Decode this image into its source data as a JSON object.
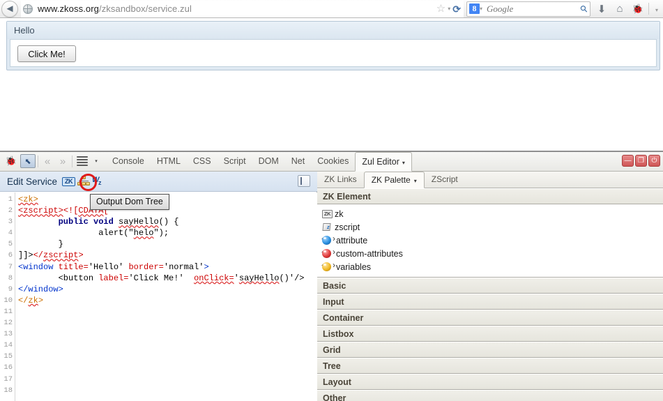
{
  "browser": {
    "back_label": "◄",
    "url_host": "www.zkoss.org",
    "url_path": "/zksandbox/service.zul",
    "star_icon": "☆",
    "caret_icon": "▾",
    "reload_icon": "⟳",
    "search_engine_badge": "8",
    "search_placeholder": "Google",
    "search_icon": "⚲",
    "download_icon": "⬇",
    "home_icon": "⌂",
    "firebug_icon": "🐞",
    "overflow_icon": "▾"
  },
  "page": {
    "window_title": "Hello",
    "button_label": "Click Me!"
  },
  "firebug": {
    "toolbar": {
      "bug_icon": "🐞",
      "inspect_icon": "⬉",
      "prev_icon": "«",
      "next_icon": "»",
      "menu_icon": "≡",
      "menu_caret": "▾",
      "tabs": [
        {
          "label": "Console",
          "active": false
        },
        {
          "label": "HTML",
          "active": false
        },
        {
          "label": "CSS",
          "active": false
        },
        {
          "label": "Script",
          "active": false
        },
        {
          "label": "DOM",
          "active": false
        },
        {
          "label": "Net",
          "active": false
        },
        {
          "label": "Cookies",
          "active": false
        },
        {
          "label": "Zul Editor",
          "active": true,
          "caret": "▾"
        }
      ],
      "window_controls": [
        {
          "name": "minimize",
          "glyph": "—"
        },
        {
          "name": "restore",
          "glyph": "❐"
        },
        {
          "name": "close",
          "glyph": "⏻"
        }
      ]
    },
    "editor": {
      "panel_title": "Edit Service",
      "icon_zk_label": "ZK",
      "icon_w2z_w": "W",
      "icon_w2z_z": "z",
      "collapse_icon": "▶",
      "tooltip": "Output Dom Tree",
      "line_numbers": [
        "1",
        "2",
        "3",
        "4",
        "5",
        "6",
        "7",
        "8",
        "9",
        "10",
        "11",
        "12",
        "13",
        "14",
        "15",
        "16",
        "17",
        "18"
      ],
      "code": [
        "<zk>",
        "<zscript><![CDATA[",
        "        public void sayHello() {",
        "                alert(\"helo\");",
        "        }",
        "]]></zscript>",
        "<window title='Hello' border='normal'>",
        "        <button label='Click Me!' onClick='sayHello()'/>",
        "</window>",
        "</zk>",
        "",
        "",
        "",
        "",
        "",
        "",
        "",
        ""
      ]
    },
    "palette": {
      "tabs": [
        {
          "label": "ZK Links",
          "active": false
        },
        {
          "label": "ZK Palette",
          "active": true,
          "caret": "▾"
        },
        {
          "label": "ZScript",
          "active": false
        }
      ],
      "sections": [
        {
          "title": "ZK Element",
          "expanded": true,
          "items": [
            {
              "label": "zk",
              "icon": "zk-badge-icon"
            },
            {
              "label": "zscript",
              "icon": "scroll-icon"
            },
            {
              "label": "attribute",
              "icon": "blue-sphere-icon"
            },
            {
              "label": "custom-attributes",
              "icon": "red-sphere-icon"
            },
            {
              "label": "variables",
              "icon": "yellow-sphere-icon"
            }
          ]
        },
        {
          "title": "Basic",
          "expanded": false,
          "items": []
        },
        {
          "title": "Input",
          "expanded": false,
          "items": []
        },
        {
          "title": "Container",
          "expanded": false,
          "items": []
        },
        {
          "title": "Listbox",
          "expanded": false,
          "items": []
        },
        {
          "title": "Grid",
          "expanded": false,
          "items": []
        },
        {
          "title": "Tree",
          "expanded": false,
          "items": []
        },
        {
          "title": "Layout",
          "expanded": false,
          "items": []
        },
        {
          "title": "Other",
          "expanded": false,
          "items": []
        }
      ]
    }
  },
  "colors": {
    "annotation_ring": "#e01b1b",
    "tag_red": "#cc0000",
    "tag_blue": "#0033cc",
    "tag_orange": "#cc7000",
    "keyword_navy": "#000080",
    "firebug_chrome": "#f3f3f1"
  }
}
